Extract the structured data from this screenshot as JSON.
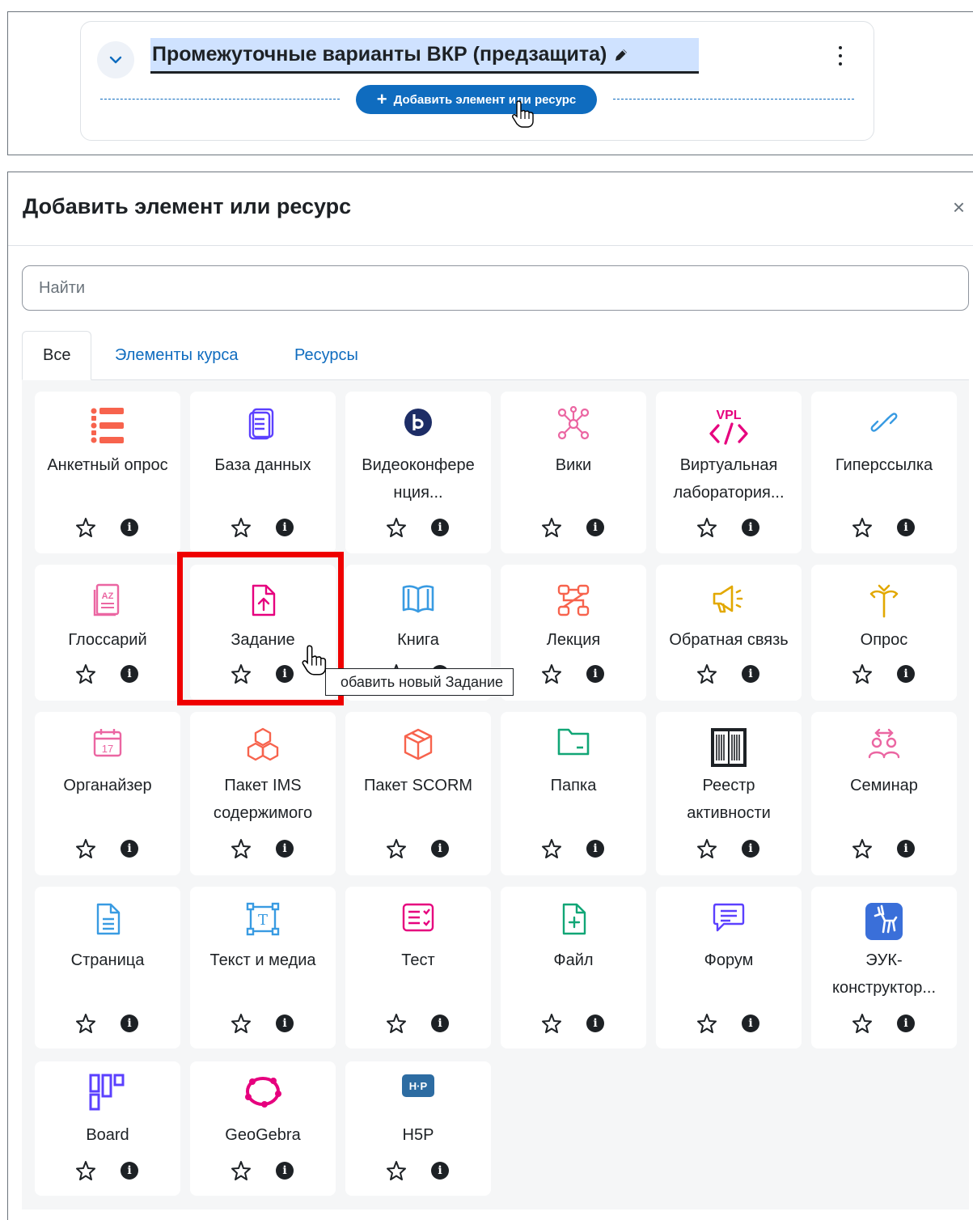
{
  "section": {
    "title": "Промежуточные варианты ВКР (предзащита)",
    "add_button": "Добавить элемент или ресурс"
  },
  "modal": {
    "title": "Добавить элемент или ресурс",
    "close": "×",
    "search_placeholder": "Найти",
    "tabs": [
      "Все",
      "Элементы курса",
      "Ресурсы"
    ],
    "tooltip": "обавить новый Задание",
    "highlighted_item": "Задание",
    "items": [
      {
        "label": "Анкетный опрос",
        "icon": "survey-icon"
      },
      {
        "label": "База данных",
        "icon": "database-icon"
      },
      {
        "label": "Видеоконфере нция...",
        "icon": "bigbluebutton-icon"
      },
      {
        "label": "Вики",
        "icon": "wiki-icon"
      },
      {
        "label": "Виртуальная лаборатория...",
        "icon": "vpl-icon"
      },
      {
        "label": "Гиперссылка",
        "icon": "link-icon"
      },
      {
        "label": "Глоссарий",
        "icon": "glossary-icon"
      },
      {
        "label": "Задание",
        "icon": "assignment-upload-icon"
      },
      {
        "label": "Книга",
        "icon": "book-icon"
      },
      {
        "label": "Лекция",
        "icon": "lesson-icon"
      },
      {
        "label": "Обратная связь",
        "icon": "feedback-megaphone-icon"
      },
      {
        "label": "Опрос",
        "icon": "choice-signpost-icon"
      },
      {
        "label": "Органайзер",
        "icon": "calendar-icon"
      },
      {
        "label": "Пакет IMS содержимого",
        "icon": "ims-package-icon"
      },
      {
        "label": "Пакет SCORM",
        "icon": "scorm-package-icon"
      },
      {
        "label": "Папка",
        "icon": "folder-icon"
      },
      {
        "label": "Реестр активности",
        "icon": "activity-register-book-icon"
      },
      {
        "label": "Семинар",
        "icon": "workshop-people-icon"
      },
      {
        "label": "Страница",
        "icon": "page-icon"
      },
      {
        "label": "Текст и медиа",
        "icon": "text-media-icon"
      },
      {
        "label": "Тест",
        "icon": "quiz-icon"
      },
      {
        "label": "Файл",
        "icon": "file-icon"
      },
      {
        "label": "Форум",
        "icon": "forum-icon"
      },
      {
        "label": "ЭУК-конструктор...",
        "icon": "euk-deer-icon"
      },
      {
        "label": "Board",
        "icon": "board-icon"
      },
      {
        "label": "GeoGebra",
        "icon": "geogebra-icon"
      },
      {
        "label": "H5P",
        "icon": "h5p-icon"
      }
    ],
    "action_icons": [
      "star-icon",
      "info-icon"
    ]
  },
  "colors": {
    "primary": "#0f6cbf",
    "title_highlight": "#cfe2ff",
    "highlight_border": "#ef0000",
    "grid_background": "#f5f6f7",
    "collaboration": "#eb66a2",
    "communication": "#11a676",
    "content": "#399be2",
    "assessment": "#5b40ff",
    "interactive": "#e2a800",
    "administration": "#f7634d"
  }
}
